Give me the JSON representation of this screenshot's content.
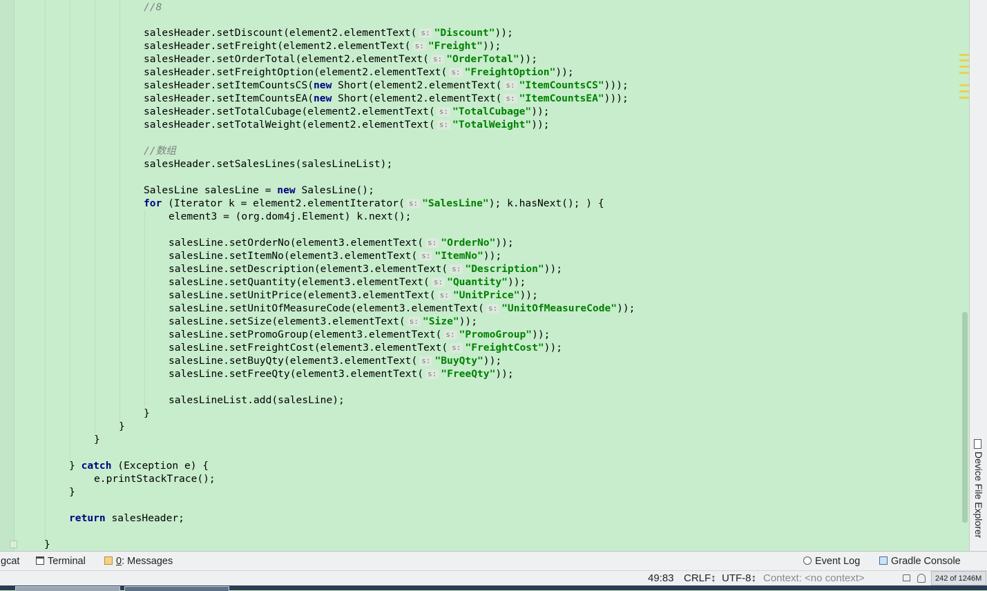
{
  "editor": {
    "hint_label": "s:",
    "code": {
      "comment_8": "//8",
      "setDiscount_pre": "salesHeader.setDiscount(element2.elementText(",
      "setDiscount_str": "\"Discount\"",
      "setDiscount_post": "));",
      "setFreight_pre": "salesHeader.setFreight(element2.elementText(",
      "setFreight_str": "\"Freight\"",
      "setFreight_post": "));",
      "setOrderTotal_pre": "salesHeader.setOrderTotal(element2.elementText(",
      "setOrderTotal_str": "\"OrderTotal\"",
      "setOrderTotal_post": "));",
      "setFreightOption_pre": "salesHeader.setFreightOption(element2.elementText(",
      "setFreightOption_str": "\"FreightOption\"",
      "setFreightOption_post": "));",
      "setItemCountsCS_pre": "salesHeader.setItemCountsCS(",
      "setItemCountsCS_kw": "new",
      "setItemCountsCS_mid": " Short(element2.elementText(",
      "setItemCountsCS_str": "\"ItemCountsCS\"",
      "setItemCountsCS_post": ")));",
      "setItemCountsEA_pre": "salesHeader.setItemCountsEA(",
      "setItemCountsEA_kw": "new",
      "setItemCountsEA_mid": " Short(element2.elementText(",
      "setItemCountsEA_str": "\"ItemCountsEA\"",
      "setItemCountsEA_post": ")));",
      "setTotalCubage_pre": "salesHeader.setTotalCubage(element2.elementText(",
      "setTotalCubage_str": "\"TotalCubage\"",
      "setTotalCubage_post": "));",
      "setTotalWeight_pre": "salesHeader.setTotalWeight(element2.elementText(",
      "setTotalWeight_str": "\"TotalWeight\"",
      "setTotalWeight_post": "));",
      "comment_array": "//数组",
      "setSalesLines": "salesHeader.setSalesLines(salesLineList);",
      "newSalesLine_pre": "SalesLine salesLine = ",
      "newSalesLine_kw": "new",
      "newSalesLine_post": " SalesLine();",
      "for_kw": "for",
      "for_pre": " (Iterator k = element2.elementIterator(",
      "for_str": "\"SalesLine\"",
      "for_post": "); k.hasNext(); ) {",
      "element3": "element3 = (org.dom4j.Element) k.next();",
      "setOrderNo_pre": "salesLine.setOrderNo(element3.elementText(",
      "setOrderNo_str": "\"OrderNo\"",
      "setOrderNo_post": "));",
      "setItemNo_pre": "salesLine.setItemNo(element3.elementText(",
      "setItemNo_str": "\"ItemNo\"",
      "setItemNo_post": "));",
      "setDescription_pre": "salesLine.setDescription(element3.elementText(",
      "setDescription_str": "\"Description\"",
      "setDescription_post": "));",
      "setQuantity_pre": "salesLine.setQuantity(element3.elementText(",
      "setQuantity_str": "\"Quantity\"",
      "setQuantity_post": "));",
      "setUnitPrice_pre": "salesLine.setUnitPrice(element3.elementText(",
      "setUnitPrice_str": "\"UnitPrice\"",
      "setUnitPrice_post": "));",
      "setUnitOfMeasureCode_pre": "salesLine.setUnitOfMeasureCode(element3.elementText(",
      "setUnitOfMeasureCode_str": "\"UnitOfMeasureCode\"",
      "setUnitOfMeasureCode_post": "));",
      "setSize_pre": "salesLine.setSize(element3.elementText(",
      "setSize_str": "\"Size\"",
      "setSize_post": "));",
      "setPromoGroup_pre": "salesLine.setPromoGroup(element3.elementText(",
      "setPromoGroup_str": "\"PromoGroup\"",
      "setPromoGroup_post": "));",
      "setFreightCost_pre": "salesLine.setFreightCost(element3.elementText(",
      "setFreightCost_str": "\"FreightCost\"",
      "setFreightCost_post": "));",
      "setBuyQty_pre": "salesLine.setBuyQty(element3.elementText(",
      "setBuyQty_str": "\"BuyQty\"",
      "setBuyQty_post": "));",
      "setFreeQty_pre": "salesLine.setFreeQty(element3.elementText(",
      "setFreeQty_str": "\"FreeQty\"",
      "setFreeQty_post": "));",
      "add": "salesLineList.add(salesLine);",
      "brace_close": "}",
      "catch_pre": "} ",
      "catch_kw": "catch",
      "catch_post": " (Exception e) {",
      "printStackTrace": "e.printStackTrace();",
      "return_kw": "return",
      "return_post": " salesHeader;"
    }
  },
  "right_sidebar": {
    "device_file_explorer_label": "Device File Explorer"
  },
  "tool_windows": {
    "logcat": "gcat",
    "terminal": "Terminal",
    "messages_num": "0",
    "messages": ": Messages",
    "event_log": "Event Log",
    "gradle_console": "Gradle Console"
  },
  "status_bar": {
    "position": "49:83",
    "line_separator": "CRLF↕",
    "encoding": "UTF-8↕",
    "context": "Context: <no context>",
    "memory": "242 of 1246M"
  },
  "colors": {
    "editor_background": "#c7edcc",
    "keyword": "#000080",
    "string": "#008000",
    "comment": "#808080",
    "scroll_marker": "#e8d252"
  }
}
